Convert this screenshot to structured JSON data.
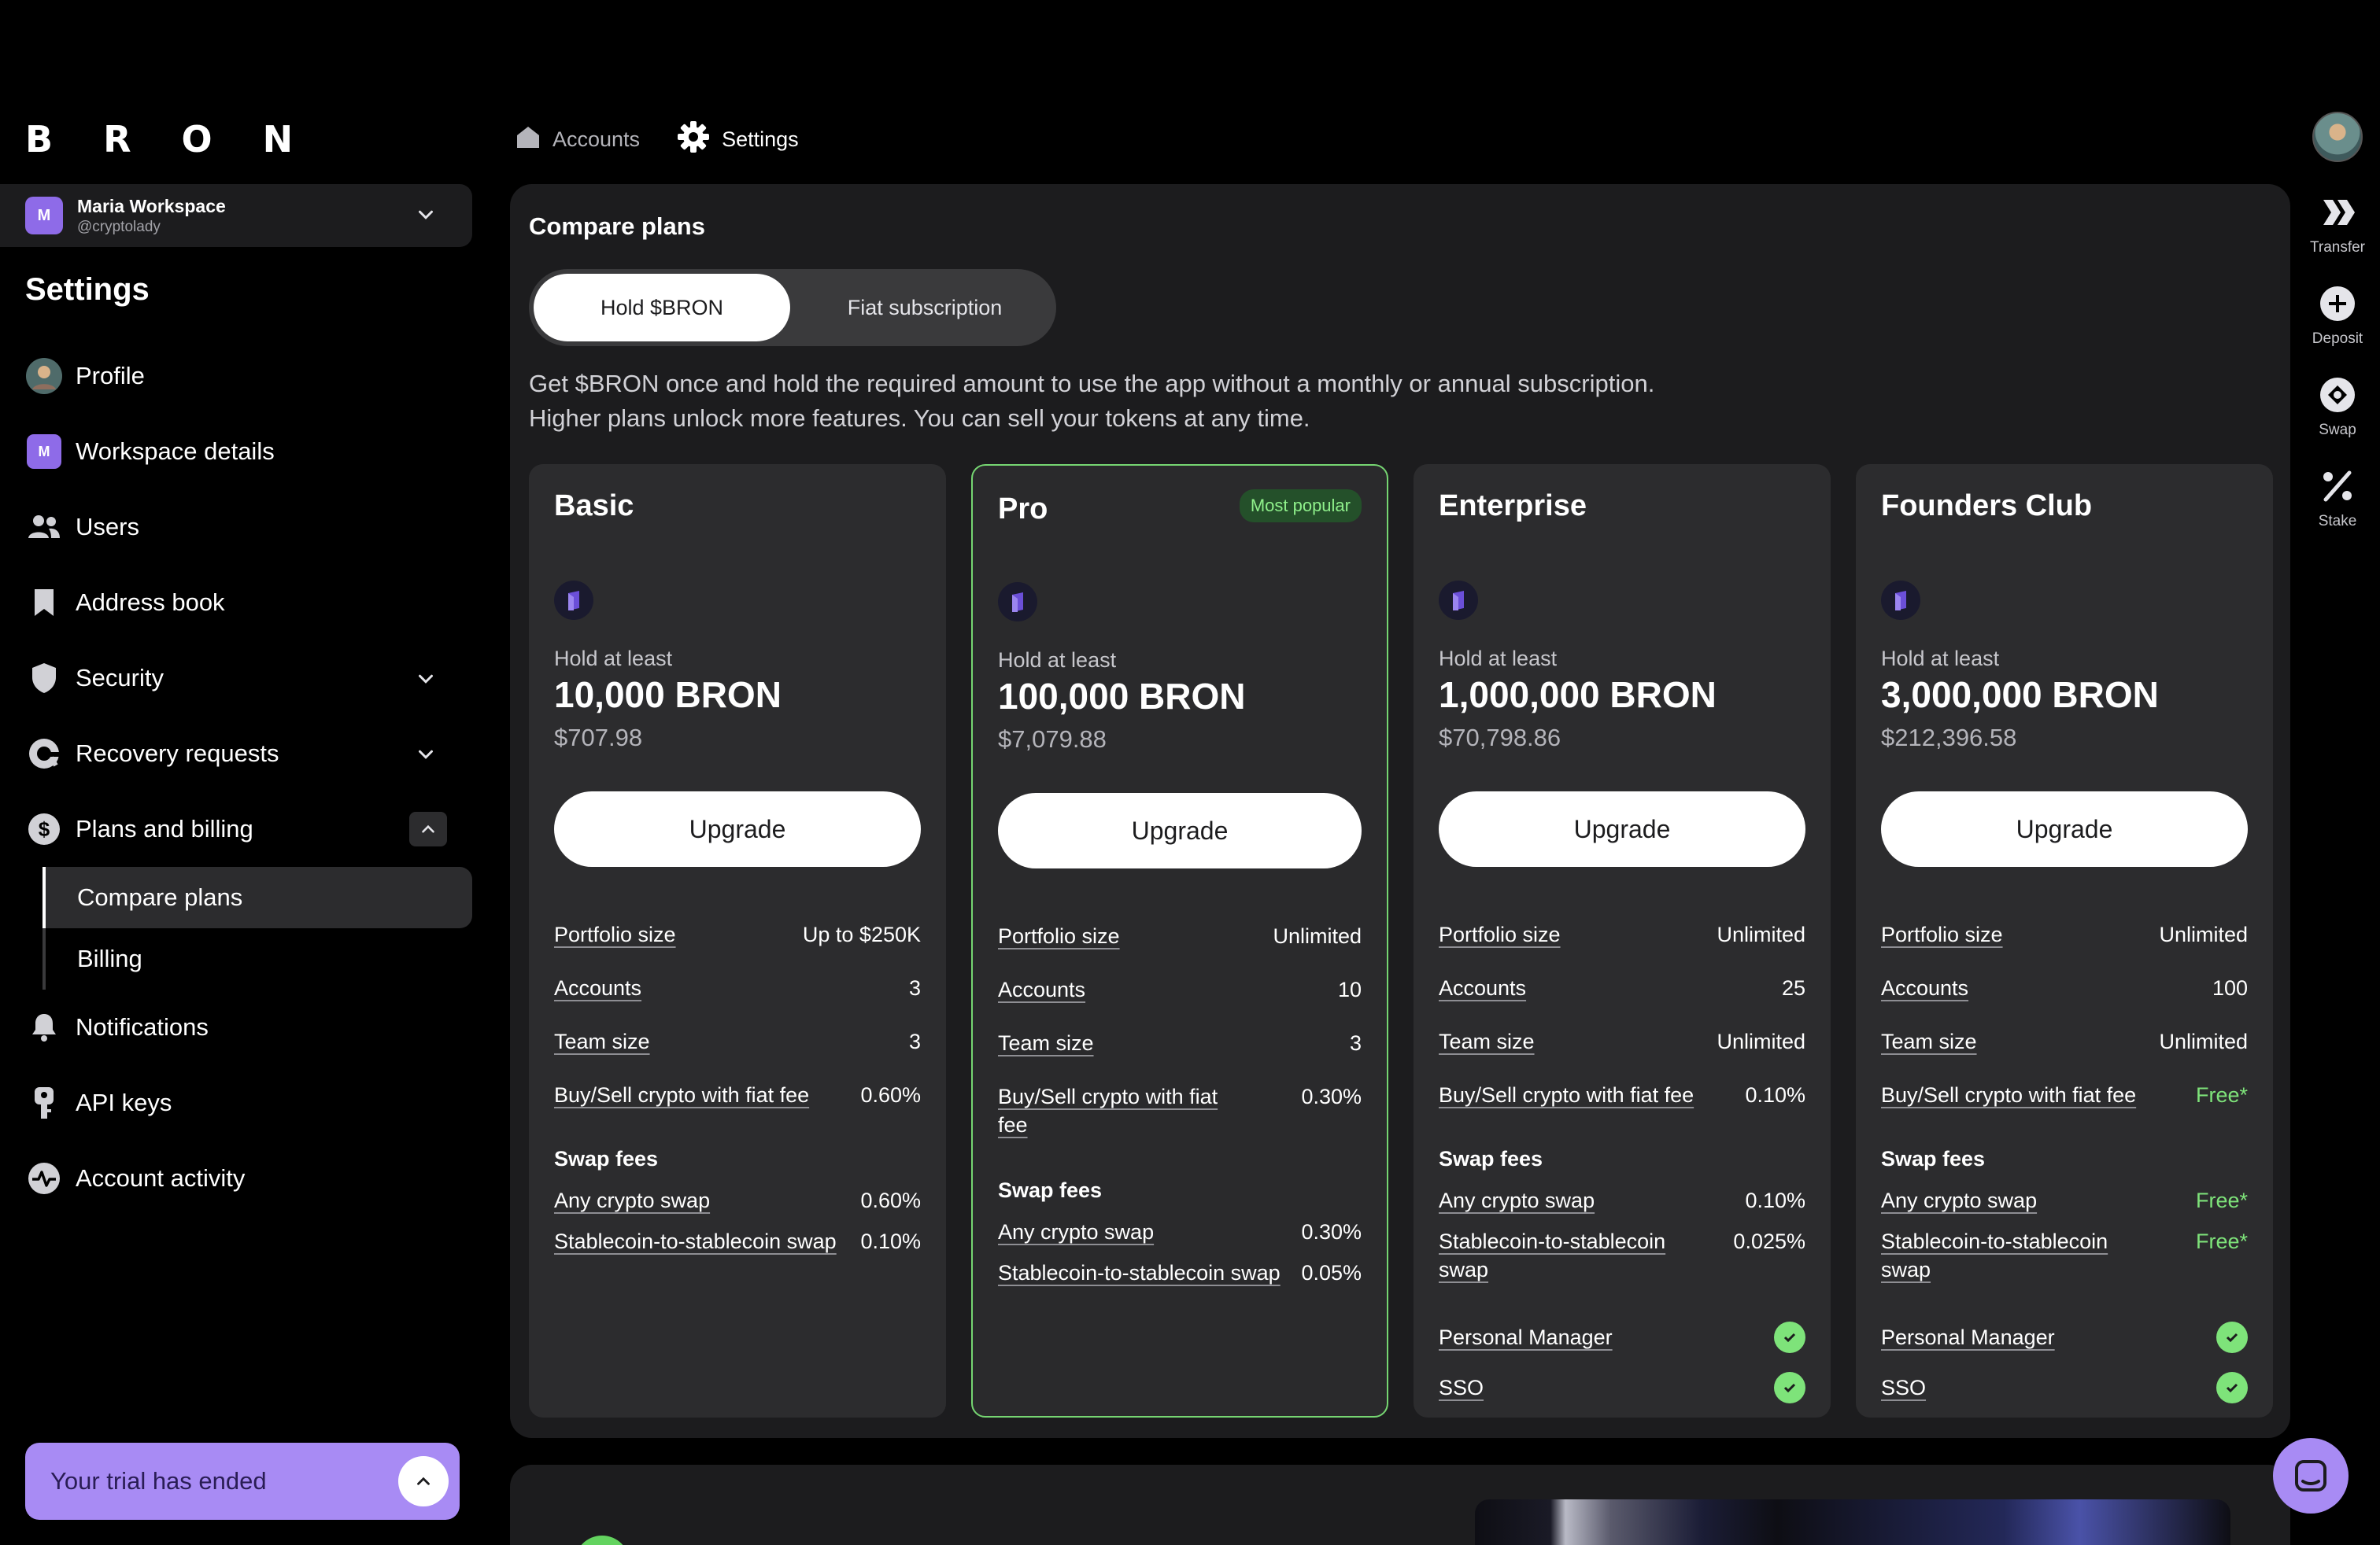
{
  "logo": [
    "B",
    "R",
    "O",
    "N"
  ],
  "workspace": {
    "initial": "M",
    "name": "Maria Workspace",
    "handle": "@cryptolady"
  },
  "sidebar": {
    "title": "Settings",
    "items": [
      {
        "label": "Profile",
        "icon": "profile-avatar-icon"
      },
      {
        "label": "Workspace details",
        "icon": "workspace-badge-icon",
        "initial": "M"
      },
      {
        "label": "Users",
        "icon": "users-icon"
      },
      {
        "label": "Address book",
        "icon": "bookmark-icon"
      },
      {
        "label": "Security",
        "icon": "shield-icon"
      },
      {
        "label": "Recovery requests",
        "icon": "recovery-icon"
      },
      {
        "label": "Plans and billing",
        "icon": "dollar-icon"
      }
    ],
    "sub_items": [
      {
        "label": "Compare plans",
        "active": true
      },
      {
        "label": "Billing",
        "active": false
      }
    ],
    "items_after": [
      {
        "label": "Notifications",
        "icon": "bell-icon"
      },
      {
        "label": "API keys",
        "icon": "key-icon"
      },
      {
        "label": "Account activity",
        "icon": "activity-icon"
      }
    ],
    "trial_text": "Your trial has ended"
  },
  "topnav": {
    "accounts": "Accounts",
    "settings": "Settings"
  },
  "rail": [
    {
      "label": "Transfer",
      "icon": "transfer-icon"
    },
    {
      "label": "Deposit",
      "icon": "plus-circle-icon"
    },
    {
      "label": "Swap",
      "icon": "swap-icon"
    },
    {
      "label": "Stake",
      "icon": "percent-icon"
    }
  ],
  "compare": {
    "title": "Compare plans",
    "toggle": {
      "active": "Hold $BRON",
      "inactive": "Fiat subscription"
    },
    "desc_line1": "Get $BRON once and hold the required amount to use the app without a monthly or annual subscription.",
    "desc_line2": "Higher plans unlock more features. You can sell your tokens at any time."
  },
  "plans": [
    {
      "name": "Basic",
      "badge": "",
      "hold_label": "Hold at least",
      "amount": "10,000 BRON",
      "usd": "$707.98",
      "cta": "Upgrade",
      "features": [
        {
          "label": "Portfolio size",
          "value": "Up to $250K"
        },
        {
          "label": "Accounts",
          "value": "3"
        },
        {
          "label": "Team size",
          "value": "3"
        },
        {
          "label": "Buy/Sell crypto with fiat fee",
          "value": "0.60%"
        }
      ],
      "swap_title": "Swap fees",
      "swap": [
        {
          "label": "Any crypto swap",
          "value": "0.60%"
        },
        {
          "label": "Stablecoin-to-stablecoin swap",
          "value": "0.10%"
        }
      ],
      "extras": []
    },
    {
      "name": "Pro",
      "badge": "Most popular",
      "hold_label": "Hold at least",
      "amount": "100,000 BRON",
      "usd": "$7,079.88",
      "cta": "Upgrade",
      "features": [
        {
          "label": "Portfolio size",
          "value": "Unlimited"
        },
        {
          "label": "Accounts",
          "value": "10"
        },
        {
          "label": "Team size",
          "value": "3"
        },
        {
          "label": "Buy/Sell crypto with fiat fee",
          "value": "0.30%"
        }
      ],
      "swap_title": "Swap fees",
      "swap": [
        {
          "label": "Any crypto swap",
          "value": "0.30%"
        },
        {
          "label": "Stablecoin-to-stablecoin swap",
          "value": "0.05%"
        }
      ],
      "extras": []
    },
    {
      "name": "Enterprise",
      "badge": "",
      "hold_label": "Hold at least",
      "amount": "1,000,000 BRON",
      "usd": "$70,798.86",
      "cta": "Upgrade",
      "features": [
        {
          "label": "Portfolio size",
          "value": "Unlimited"
        },
        {
          "label": "Accounts",
          "value": "25"
        },
        {
          "label": "Team size",
          "value": "Unlimited"
        },
        {
          "label": "Buy/Sell crypto with fiat fee",
          "value": "0.10%"
        }
      ],
      "swap_title": "Swap fees",
      "swap": [
        {
          "label": "Any crypto swap",
          "value": "0.10%"
        },
        {
          "label": "Stablecoin-to-stablecoin swap",
          "value": "0.025%"
        }
      ],
      "extras": [
        "Personal Manager",
        "SSO"
      ]
    },
    {
      "name": "Founders Club",
      "badge": "",
      "hold_label": "Hold at least",
      "amount": "3,000,000 BRON",
      "usd": "$212,396.58",
      "cta": "Upgrade",
      "features": [
        {
          "label": "Portfolio size",
          "value": "Unlimited"
        },
        {
          "label": "Accounts",
          "value": "100"
        },
        {
          "label": "Team size",
          "value": "Unlimited"
        },
        {
          "label": "Buy/Sell crypto with fiat fee",
          "value": "Free*"
        }
      ],
      "swap_title": "Swap fees",
      "swap": [
        {
          "label": "Any crypto swap",
          "value": "Free*"
        },
        {
          "label": "Stablecoin-to-stablecoin swap",
          "value": "Free*"
        }
      ],
      "extras": [
        "Personal Manager",
        "SSO"
      ]
    }
  ],
  "colors": {
    "accent_green": "#7ee37a",
    "accent_purple": "#a88bf4",
    "panel": "#1c1c1e",
    "card": "#2c2c2e"
  }
}
